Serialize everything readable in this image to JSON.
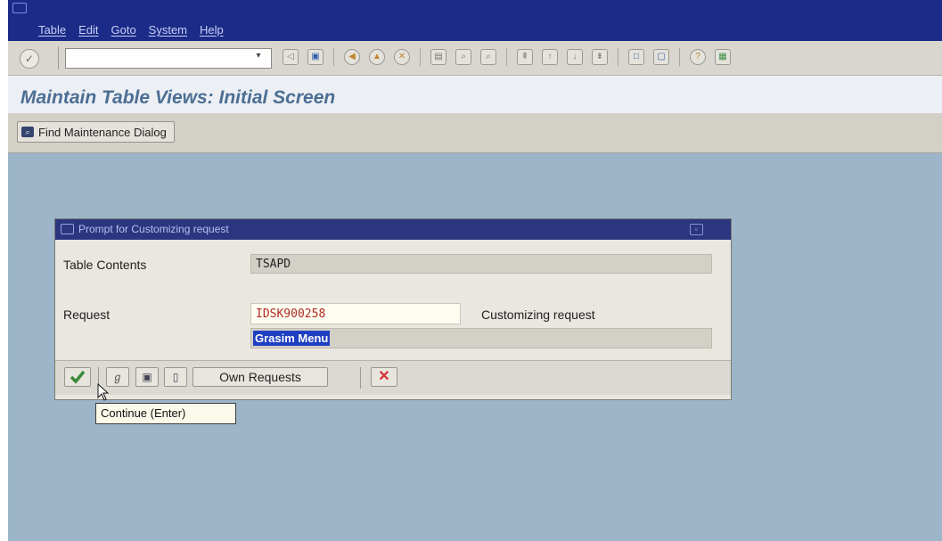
{
  "menu": {
    "items": [
      "Table",
      "Edit",
      "Goto",
      "System",
      "Help"
    ]
  },
  "toolbar": {
    "enter_icon": "enter-icon",
    "command_field_value": "",
    "command_dropdown_glyph": "▾"
  },
  "page": {
    "title": "Maintain Table Views: Initial Screen"
  },
  "app_toolbar": {
    "find_button_label": "Find Maintenance Dialog"
  },
  "dialog": {
    "title": "Prompt for Customizing request",
    "table_contents_label": "Table Contents",
    "table_contents_value": "TSAPD",
    "request_label": "Request",
    "request_value": "IDSK900258",
    "request_type": "Customizing request",
    "request_description": "Grasim Menu",
    "own_requests_label": "Own Requests"
  },
  "tooltip": {
    "text": "Continue  (Enter)"
  },
  "colors": {
    "menubar": "#1c2b88",
    "workspace": "#9cb5c8",
    "title_text": "#4c6e94",
    "selection": "#1f3fc2",
    "request_text": "#b02a1f",
    "cancel": "#d32f2f",
    "check": "#3a8a3a"
  }
}
